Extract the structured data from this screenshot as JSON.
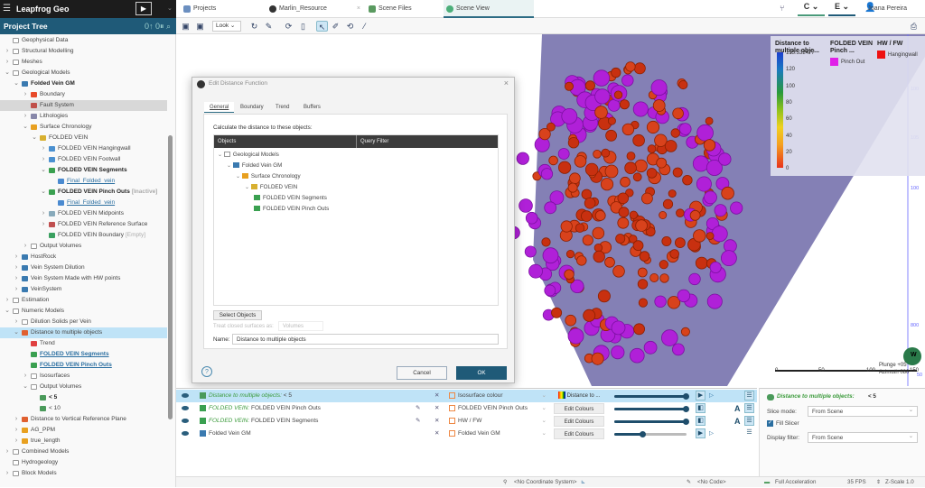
{
  "app": {
    "title": "Leapfrog Geo",
    "menu_icon": "hamburger-icon",
    "play_icon": "play-icon"
  },
  "tabs": [
    {
      "label": "Projects",
      "color": "#6b8fc0"
    },
    {
      "label": "Marlin_Resource",
      "close": "×",
      "color": "#333"
    },
    {
      "label": "Scene Files",
      "color": "#5a9a60"
    },
    {
      "label": "Scene View",
      "color": "#4caf7a"
    }
  ],
  "user": {
    "name": "Joana Pereira"
  },
  "project_tree": {
    "title": "Project Tree",
    "tools": "0↑  0⏸  ⌕",
    "items": [
      {
        "label": "Geophysical Data",
        "depth": 0,
        "chev": "",
        "icon": "folder"
      },
      {
        "label": "Structural Modelling",
        "depth": 0,
        "chev": ">",
        "icon": "folder"
      },
      {
        "label": "Meshes",
        "depth": 0,
        "chev": ">",
        "icon": "folder"
      },
      {
        "label": "Geological Models",
        "depth": 0,
        "chev": "v",
        "icon": "folder"
      },
      {
        "label": "Folded Vein GM",
        "depth": 1,
        "chev": "v",
        "icon": "gm",
        "style": "bold"
      },
      {
        "label": "Boundary",
        "depth": 2,
        "chev": ">",
        "icon": "boundary"
      },
      {
        "label": "Fault System",
        "depth": 2,
        "chev": "",
        "icon": "fault",
        "state": "gray"
      },
      {
        "label": "Lithologies",
        "depth": 2,
        "chev": ">",
        "icon": "lith"
      },
      {
        "label": "Surface Chronology",
        "depth": 2,
        "chev": "v",
        "icon": "chron"
      },
      {
        "label": "FOLDED VEIN",
        "depth": 3,
        "chev": "v",
        "icon": "vein"
      },
      {
        "label": "FOLDED VEIN Hangingwall",
        "depth": 4,
        "chev": ">",
        "icon": "surf"
      },
      {
        "label": "FOLDED VEIN Footwall",
        "depth": 4,
        "chev": ">",
        "icon": "surf"
      },
      {
        "label": "FOLDED VEIN Segments",
        "depth": 4,
        "chev": "v",
        "icon": "pts",
        "style": "bold"
      },
      {
        "label": "Final_Folded_vein",
        "depth": 5,
        "chev": "",
        "icon": "link",
        "style": "link"
      },
      {
        "label": "FOLDED VEIN Pinch Outs",
        "depth": 4,
        "chev": "v",
        "icon": "pts",
        "style": "bold",
        "suffix": "[Inactive]"
      },
      {
        "label": "Final_Folded_vein",
        "depth": 5,
        "chev": "",
        "icon": "link",
        "style": "link"
      },
      {
        "label": "FOLDED VEIN Midpoints",
        "depth": 4,
        "chev": ">",
        "icon": "mid"
      },
      {
        "label": "FOLDED VEIN Reference Surface",
        "depth": 4,
        "chev": ">",
        "icon": "ref"
      },
      {
        "label": "FOLDED VEIN Boundary",
        "depth": 4,
        "chev": "",
        "icon": "bnd",
        "suffix": "[Empty]"
      },
      {
        "label": "Output Volumes",
        "depth": 2,
        "chev": ">",
        "icon": "folder"
      },
      {
        "label": "HostRock",
        "depth": 1,
        "chev": ">",
        "icon": "gm"
      },
      {
        "label": "Vein System Dilution",
        "depth": 1,
        "chev": ">",
        "icon": "gm"
      },
      {
        "label": "Vein System Made with HW points",
        "depth": 1,
        "chev": ">",
        "icon": "gm"
      },
      {
        "label": "VeinSystem",
        "depth": 1,
        "chev": ">",
        "icon": "gm"
      },
      {
        "label": "Estimation",
        "depth": 0,
        "chev": ">",
        "icon": "folder"
      },
      {
        "label": "Numeric Models",
        "depth": 0,
        "chev": "v",
        "icon": "folder"
      },
      {
        "label": "Dilution Solids per Vein",
        "depth": 1,
        "chev": ">",
        "icon": "folder"
      },
      {
        "label": "Distance to multiple objects",
        "depth": 1,
        "chev": "v",
        "icon": "dist",
        "state": "blue"
      },
      {
        "label": "Trend",
        "depth": 2,
        "chev": "",
        "icon": "trend"
      },
      {
        "label": "FOLDED VEIN Segments",
        "depth": 2,
        "chev": "",
        "icon": "pts",
        "style": "boldlink"
      },
      {
        "label": "FOLDED VEIN Pinch Outs",
        "depth": 2,
        "chev": "",
        "icon": "pts",
        "style": "boldlink"
      },
      {
        "label": "Isosurfaces",
        "depth": 2,
        "chev": ">",
        "icon": "folder"
      },
      {
        "label": "Output Volumes",
        "depth": 2,
        "chev": "v",
        "icon": "folder"
      },
      {
        "label": "< 5",
        "depth": 3,
        "chev": "",
        "icon": "vol",
        "style": "bold"
      },
      {
        "label": "< 10",
        "depth": 3,
        "chev": "",
        "icon": "vol"
      },
      {
        "label": "Distance to Vertical Reference Plane",
        "depth": 1,
        "chev": ">",
        "icon": "dist"
      },
      {
        "label": "AG_PPM",
        "depth": 1,
        "chev": ">",
        "icon": "rbf"
      },
      {
        "label": "true_length",
        "depth": 1,
        "chev": ">",
        "icon": "rbf"
      },
      {
        "label": "Combined Models",
        "depth": 0,
        "chev": ">",
        "icon": "folder"
      },
      {
        "label": "Hydrogeology",
        "depth": 0,
        "chev": "",
        "icon": "folder"
      },
      {
        "label": "Block Models",
        "depth": 0,
        "chev": ">",
        "icon": "folder"
      }
    ]
  },
  "toolbar": {
    "look_label": "Look"
  },
  "legend": {
    "distance": {
      "title": "Distance to multiple obje...",
      "ticks": [
        "135.532477",
        "120",
        "100",
        "80",
        "60",
        "40",
        "20",
        "0"
      ]
    },
    "pinch": {
      "title": "FOLDED VEIN Pinch ...",
      "entry": "Pinch Out",
      "color": "#e020e8"
    },
    "hwfw": {
      "title": "HW / FW",
      "entry": "Hangingwall",
      "color": "#ee1111"
    }
  },
  "scene": {
    "plunge": "Plunge +05",
    "azimuth": "Azimuth 080",
    "scale_ticks": [
      "0",
      "50",
      "100",
      "150"
    ],
    "axis_labels": [
      "100",
      "105",
      "100",
      "800",
      "50"
    ],
    "compass": "W"
  },
  "dialog": {
    "title": "Edit Distance Function",
    "close": "×",
    "tabs": [
      "General",
      "Boundary",
      "Trend",
      "Buffers"
    ],
    "instruction": "Calculate the distance to these objects:",
    "columns": [
      "Objects",
      "Query Filter"
    ],
    "objects": [
      {
        "label": "Geological Models",
        "depth": 0,
        "chev": "v",
        "icon": "folder"
      },
      {
        "label": "Folded Vein GM",
        "depth": 1,
        "chev": "v",
        "icon": "gm"
      },
      {
        "label": "Surface Chronology",
        "depth": 2,
        "chev": "v",
        "icon": "chron"
      },
      {
        "label": "FOLDED VEIN",
        "depth": 3,
        "chev": "v",
        "icon": "vein"
      },
      {
        "label": "FOLDED VEIN Segments",
        "depth": 4,
        "chev": "",
        "icon": "pts"
      },
      {
        "label": "FOLDED VEIN Pinch Outs",
        "depth": 4,
        "chev": "",
        "icon": "pts"
      }
    ],
    "select_objects": "Select Objects",
    "treat_label": "Treat closed surfaces as:",
    "treat_value": "Volumes",
    "name_label": "Name:",
    "name_value": "Distance to multiple objects",
    "cancel": "Cancel",
    "ok": "OK",
    "help": "?"
  },
  "shapes": [
    {
      "prefix": "Distance to multiple objects:",
      "name": "< 5",
      "colour": "Isosurface colour",
      "colour2": "Distance to ...",
      "slider": 1.0,
      "selected": true
    },
    {
      "prefix": "FOLDED VEIN:",
      "name": "FOLDED VEIN Pinch Outs",
      "colour": "FOLDED VEIN Pinch Outs",
      "edit": "Edit Colours",
      "slider": 1.0
    },
    {
      "prefix": "FOLDED VEIN:",
      "name": "FOLDED VEIN Segments",
      "colour": "HW / FW",
      "edit": "Edit Colours",
      "slider": 1.0
    },
    {
      "prefix": "",
      "name": "Folded Vein GM",
      "colour": "Folded Vein GM",
      "edit": "Edit Colours",
      "slider": 0.4
    }
  ],
  "properties": {
    "title_prefix": "Distance to multiple objects:",
    "title_name": "< 5",
    "slice_mode_label": "Slice mode:",
    "slice_mode": "From Scene",
    "fill_slicer": "Fill Slicer",
    "fill_slicer_checked": true,
    "display_filter_label": "Display filter:",
    "display_filter": "From Scene"
  },
  "status": {
    "coord": "<No Coordinate System>",
    "code": "<No Code>",
    "accel": "Full Acceleration",
    "fps": "35 FPS",
    "zscale": "Z-Scale 1.0"
  }
}
